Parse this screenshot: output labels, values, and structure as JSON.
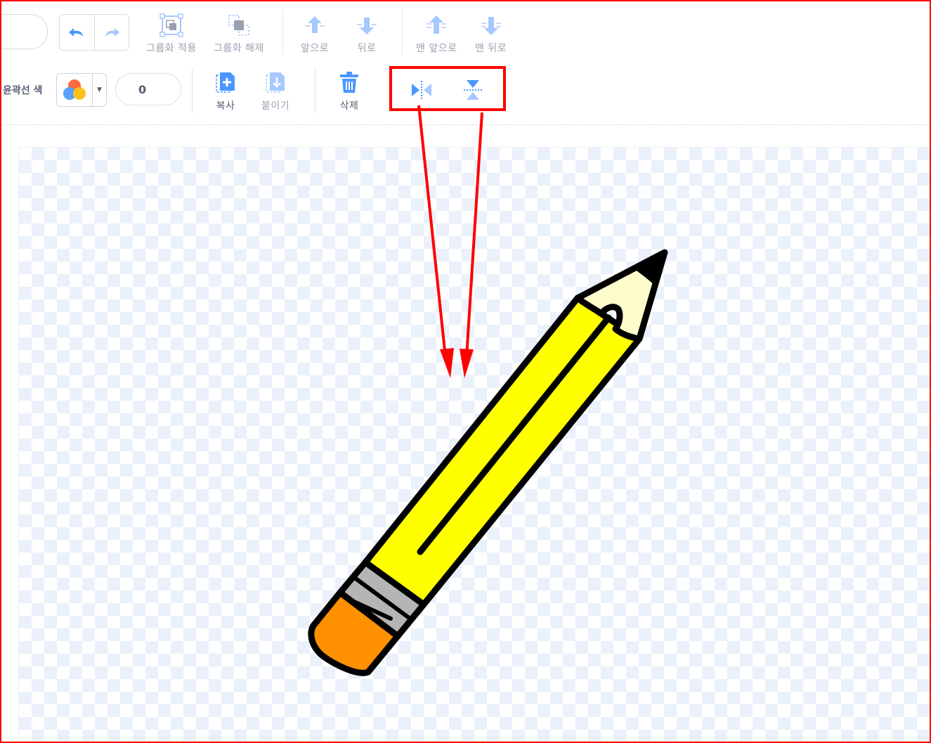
{
  "toolbar": {
    "group_label": "그룹화 적용",
    "ungroup_label": "그룹화 해제",
    "forward_label": "앞으로",
    "backward_label": "뒤로",
    "front_label": "맨 앞으로",
    "back_label": "맨 뒤로",
    "copy_label": "복사",
    "paste_label": "붙이기",
    "delete_label": "삭제"
  },
  "outline": {
    "label": "윤곽선 색",
    "width_value": "0"
  },
  "icons": {
    "undo": "undo-icon",
    "redo": "redo-icon",
    "group": "group-icon",
    "ungroup": "ungroup-icon",
    "forward": "arrow-up-icon",
    "backward": "arrow-down-icon",
    "front": "front-icon",
    "back": "back-icon",
    "copy": "copy-icon",
    "paste": "paste-icon",
    "delete": "trash-icon",
    "flip_horizontal": "flip-horizontal-icon",
    "flip_vertical": "flip-vertical-icon"
  },
  "colors": {
    "accent": "#4c97ff",
    "disabled": "#9aa0b0",
    "annotation": "#ff0000",
    "pencil_body": "#ffff00",
    "pencil_eraser": "#ff9000",
    "pencil_wood": "#fffccc"
  }
}
